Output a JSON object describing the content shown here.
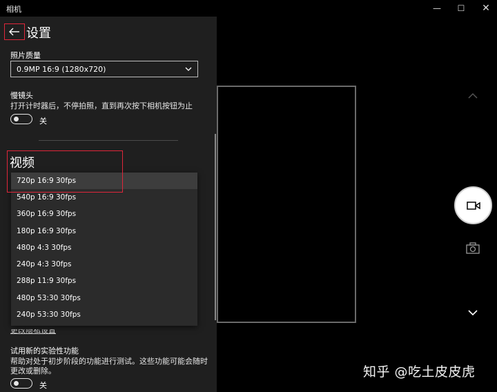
{
  "window": {
    "title": "相机",
    "minimize": "—",
    "maximize": "☐",
    "close": "✕"
  },
  "settings": {
    "title": "设置",
    "photo_quality": {
      "label": "照片质量",
      "value": "0.9MP 16:9 (1280x720)"
    },
    "time_lapse": {
      "label": "慢镜头",
      "description": "打开计时器后，不停拍照，直到再次按下相机按钮为止",
      "toggle_state": "关"
    },
    "video": {
      "section_title": "视频",
      "options": [
        "720p 16:9 30fps",
        "540p 16:9 30fps",
        "360p 16:9 30fps",
        "180p 16:9 30fps",
        "480p 4:3 30fps",
        "240p 4:3 30fps",
        "288p 11:9 30fps",
        "480p 53:30 30fps",
        "240p 53:30 30fps"
      ],
      "selected_index": 0
    },
    "partial_link": "更改隐私设置",
    "experimental": {
      "label": "试用新的实验性功能",
      "description_line1": "帮助对处于初步阶段的功能进行测试。这些功能可能会随时",
      "description_line2": "更改或删除。",
      "toggle_state": "关"
    }
  },
  "icons": {
    "back": "back-arrow-icon",
    "record": "video-camera-icon",
    "photo": "camera-icon",
    "up": "chevron-up-icon",
    "down": "chevron-down-icon"
  },
  "colors": {
    "highlight": "#e0263a",
    "panel_bg": "#1f1f1f",
    "dropdown_bg": "#2b2b2b"
  },
  "watermark": "知乎 @吃土皮皮虎"
}
